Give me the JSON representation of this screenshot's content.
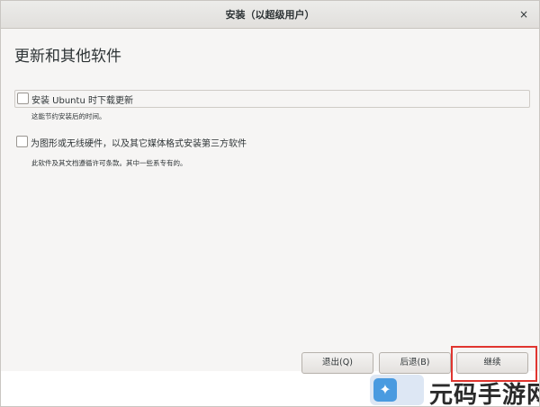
{
  "window": {
    "title": "安装（以超级用户）",
    "close_glyph": "×"
  },
  "page": {
    "title": "更新和其他软件"
  },
  "options": [
    {
      "label": "安装 Ubuntu 时下载更新",
      "description": "这能节约安装后的时间。",
      "checked": false
    },
    {
      "label": "为图形或无线硬件，以及其它媒体格式安装第三方软件",
      "description": "此软件及其文档遵循许可条款。其中一些系专有的。",
      "checked": false
    }
  ],
  "buttons": {
    "quit": "退出(Q)",
    "back": "后退(B)",
    "continue": "继续"
  },
  "watermark": {
    "text": "元码手游网",
    "logo_icon": "bird-logo-icon"
  },
  "colors": {
    "highlight": "#e0352f",
    "logo": "#4a9be0"
  }
}
